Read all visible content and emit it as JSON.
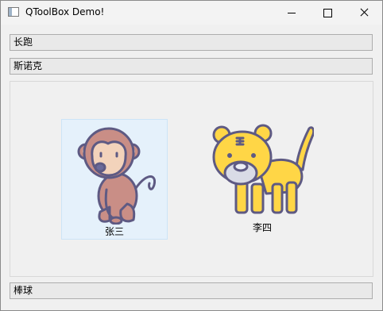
{
  "window": {
    "title": "QToolBox Demo!",
    "icon": "app-window-icon",
    "controls": [
      "minimize-icon",
      "maximize-icon",
      "close-icon"
    ]
  },
  "toolbox": {
    "sections": [
      {
        "label": "长跑",
        "expanded": false
      },
      {
        "label": "斯诺克",
        "expanded": true
      },
      {
        "label": "棒球",
        "expanded": false
      }
    ],
    "items": [
      {
        "label": "张三",
        "icon": "monkey-icon",
        "selected": true
      },
      {
        "label": "李四",
        "icon": "tiger-icon",
        "selected": false
      }
    ]
  },
  "colors": {
    "selection_bg": "#e5f1fb",
    "monkey_body": "#c98e86",
    "tiger_body": "#ffd646",
    "outline": "#5e5a83"
  }
}
